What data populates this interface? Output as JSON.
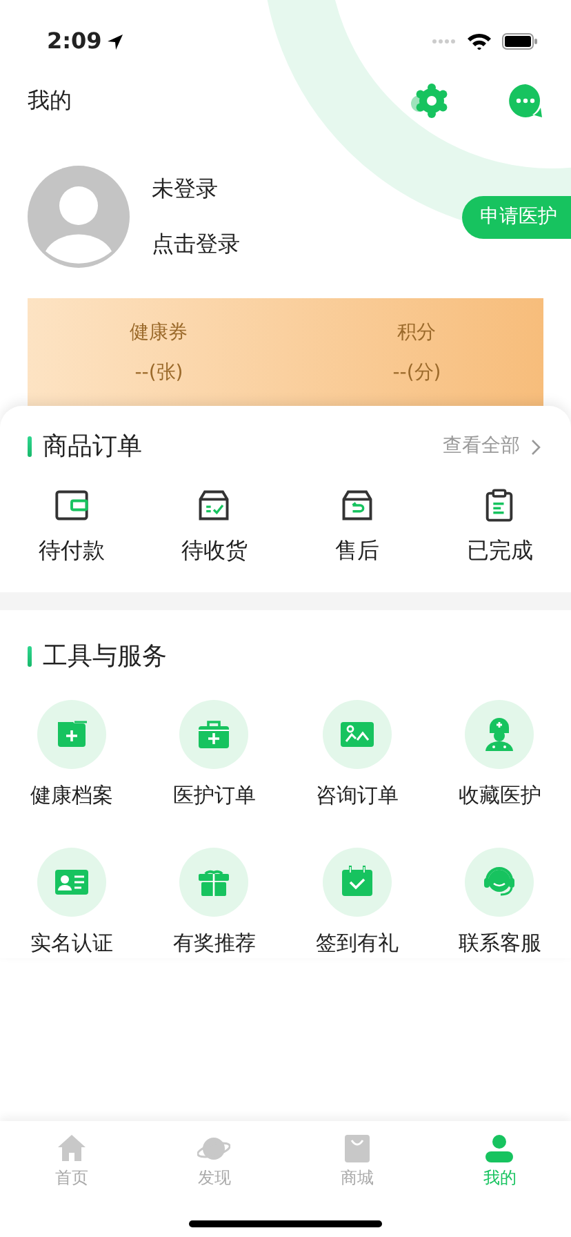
{
  "status_bar": {
    "time": "2:09"
  },
  "header": {
    "title": "我的"
  },
  "profile": {
    "name": "未登录",
    "hint": "点击登录",
    "apply_button": "申请医护"
  },
  "stats": [
    {
      "label": "健康券",
      "value": "--(张)"
    },
    {
      "label": "积分",
      "value": "--(分)"
    }
  ],
  "orders": {
    "title": "商品订单",
    "view_all": "查看全部",
    "items": [
      "待付款",
      "待收货",
      "售后",
      "已完成"
    ]
  },
  "services": {
    "title": "工具与服务",
    "items": [
      "健康档案",
      "医护订单",
      "咨询订单",
      "收藏医护",
      "实名认证",
      "有奖推荐",
      "签到有礼",
      "联系客服"
    ]
  },
  "tab_bar": [
    {
      "label": "首页",
      "selected": false
    },
    {
      "label": "发现",
      "selected": false
    },
    {
      "label": "商城",
      "selected": false
    },
    {
      "label": "我的",
      "selected": true
    }
  ]
}
